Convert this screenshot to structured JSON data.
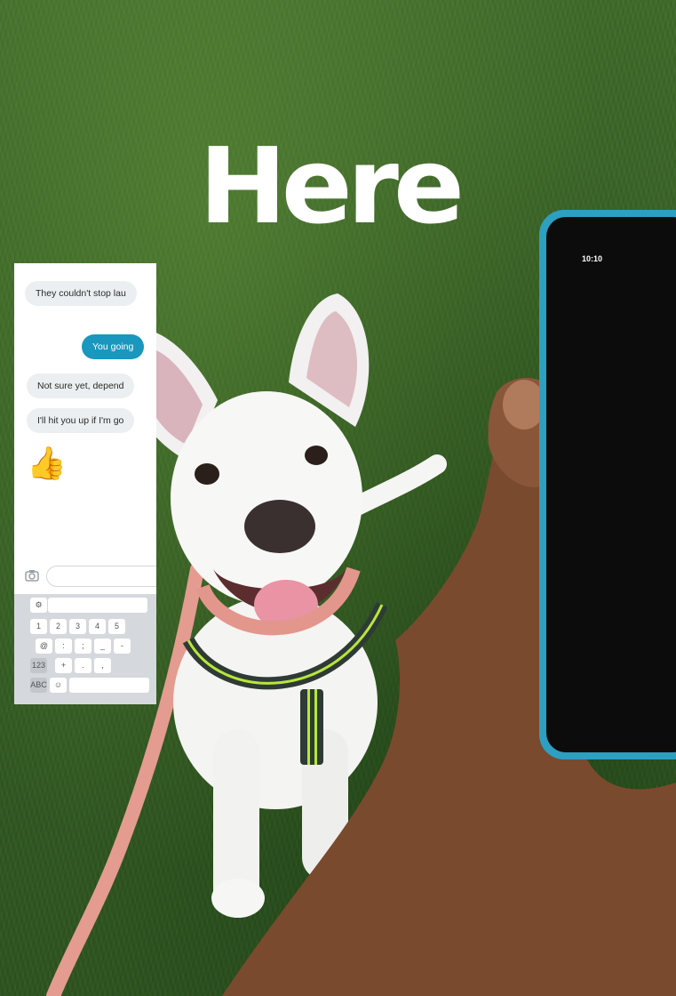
{
  "headline": "Here",
  "phone": {
    "status_time": "10:10",
    "messages": [
      {
        "text": "They couldn't stop lau",
        "side": "in"
      },
      {
        "text": "You going",
        "side": "out"
      },
      {
        "text": "Not sure yet, depend",
        "side": "in"
      },
      {
        "text": "I'll hit you up if I'm go",
        "side": "in"
      }
    ],
    "reaction_emoji": "👍",
    "keyboard": {
      "row_numbers": [
        "1",
        "2",
        "3",
        "4",
        "5"
      ],
      "row_symbols": [
        "@",
        ":",
        ";",
        "_",
        "-"
      ],
      "row_misc": [
        "123",
        "+",
        ".",
        ","
      ],
      "row_bottom": [
        "ABC",
        "☺"
      ]
    }
  },
  "colors": {
    "grass": "#3a6526",
    "phone_case": "#2d9fc1",
    "outgoing_bubble": "#1a97be",
    "headline_text": "#ffffff",
    "leash": "#e79a8f",
    "harness": "#b7e63a"
  },
  "icons": [
    "camera-icon",
    "thumbs-up-emoji"
  ]
}
